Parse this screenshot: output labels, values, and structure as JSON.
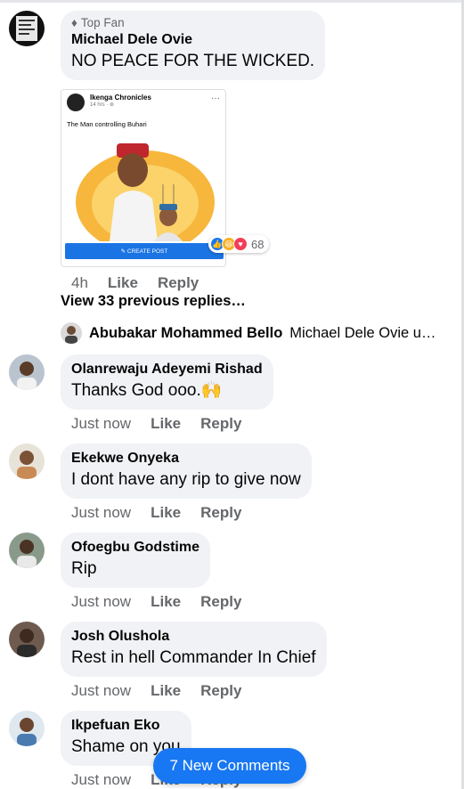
{
  "comments": [
    {
      "badge": "Top Fan",
      "name": "Michael Dele Ovie",
      "text": "NO PEACE FOR THE WICKED.",
      "time": "4h",
      "like": "Like",
      "reply": "Reply",
      "media": {
        "page": "Ikenga Chronicles",
        "meta": "14 hrs · ⊛",
        "caption": "The Man controlling Buhari",
        "button": "✎ CREATE POST"
      },
      "reactions": {
        "count": "68"
      }
    },
    {
      "name": "Olanrewaju Adeyemi Rishad",
      "text": "Thanks God ooo.🙌",
      "time": "Just now",
      "like": "Like",
      "reply": "Reply"
    },
    {
      "name": "Ekekwe Onyeka",
      "text": "I dont have any rip to give now",
      "time": "Just now",
      "like": "Like",
      "reply": "Reply"
    },
    {
      "name": "Ofoegbu Godstime",
      "text": "Rip",
      "time": "Just now",
      "like": "Like",
      "reply": "Reply"
    },
    {
      "name": "Josh Olushola",
      "text": "Rest in hell Commander In Chief",
      "time": "Just now",
      "like": "Like",
      "reply": "Reply"
    },
    {
      "name": "Ikpefuan Eko",
      "text": "Shame on you",
      "time": "Just now",
      "like": "Like",
      "reply": "Reply"
    }
  ],
  "thread": {
    "view_previous": "View 33 previous replies…",
    "latest_reply_name": "Abubakar Mohammed Bello",
    "latest_reply_text": "Michael Dele Ovie u…"
  },
  "new_comments": "7 New Comments",
  "colors": {
    "accent": "#1877f2",
    "bubble": "#f0f2f5",
    "muted": "#65676b"
  }
}
